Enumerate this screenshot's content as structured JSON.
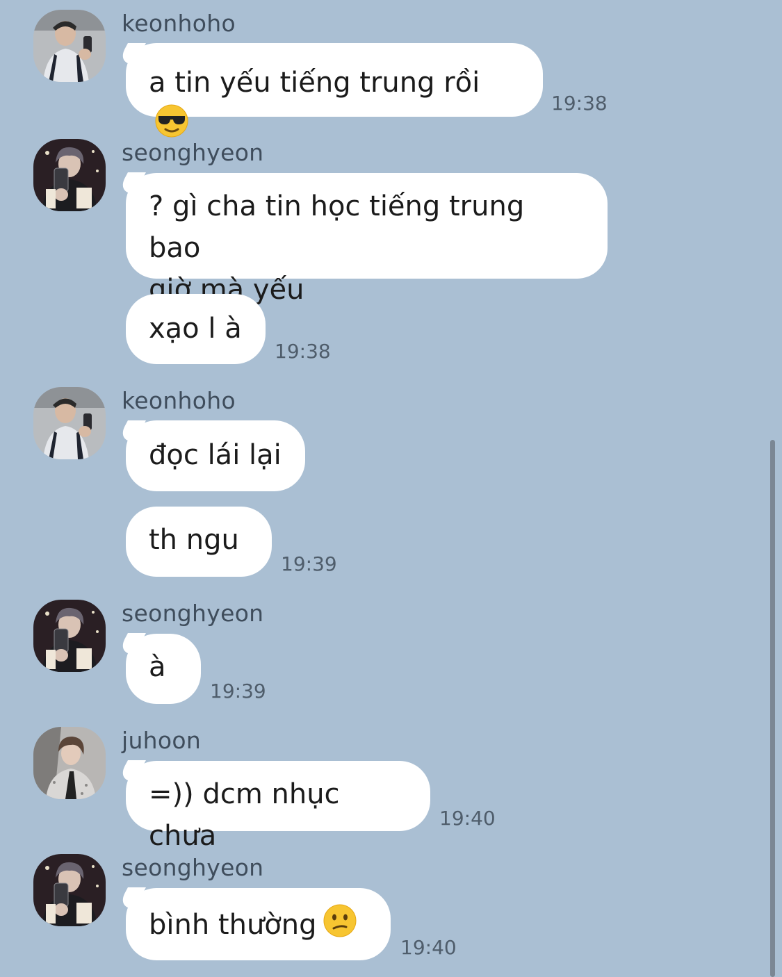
{
  "messages": [
    {
      "sender": "keonhoho",
      "avatar": "avatar-keonhoho",
      "texts": [
        "a tin yếu tiếng trung rồi"
      ],
      "emoji": "sunglasses-emoji",
      "time": "19:38"
    },
    {
      "sender": "seonghyeon",
      "avatar": "avatar-seonghyeon",
      "texts": [
        "? gì cha tin học tiếng trung bao\ngiờ mà yếu",
        "xạo l à"
      ],
      "time": "19:38"
    },
    {
      "sender": "keonhoho",
      "avatar": "avatar-keonhoho",
      "texts": [
        "đọc lái lại",
        "th ngu"
      ],
      "time": "19:39"
    },
    {
      "sender": "seonghyeon",
      "avatar": "avatar-seonghyeon",
      "texts": [
        "à"
      ],
      "time": "19:39"
    },
    {
      "sender": "juhoon",
      "avatar": "avatar-juhoon",
      "texts": [
        "=)) dcm nhục chưa"
      ],
      "time": "19:40"
    },
    {
      "sender": "seonghyeon",
      "avatar": "avatar-seonghyeon",
      "texts": [
        "bình thường"
      ],
      "emoji": "confused-emoji",
      "time": "19:40"
    }
  ],
  "colors": {
    "background": "#aabfd3",
    "bubble": "#ffffff",
    "sender_text": "#3f4d5c",
    "time_text": "#4f5d6b",
    "scrollbar": "#7b8794"
  }
}
